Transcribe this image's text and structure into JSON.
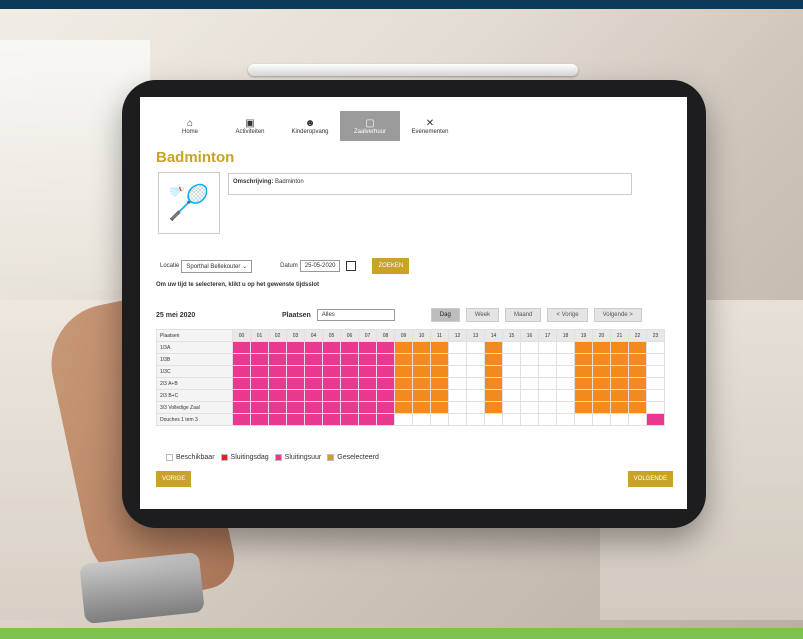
{
  "nav": [
    {
      "icon": "home-icon",
      "glyph": "⌂",
      "label": "Home",
      "active": false
    },
    {
      "icon": "calendar-icon",
      "glyph": "▣",
      "label": "Activiteiten",
      "active": false
    },
    {
      "icon": "child-icon",
      "glyph": "☻",
      "label": "Kinderopvang",
      "active": false
    },
    {
      "icon": "hall-icon",
      "glyph": "▢",
      "label": "Zaalverhuur",
      "active": true
    },
    {
      "icon": "party-icon",
      "glyph": "✕",
      "label": "Evenementen",
      "active": false
    }
  ],
  "page": {
    "title": "Badminton",
    "desc_label": "Omschrijving:",
    "desc_value": "Badminton",
    "locatie_label": "Locatie",
    "locatie_value": "Sporthal Bellekouter",
    "datum_label": "Datum",
    "datum_value": "25-05-2020",
    "search_label": "ZOEKEN",
    "hint": "Om uw tijd te selecteren, klikt u op het gewenste tijdsslot"
  },
  "controls": {
    "date": "25 mei 2020",
    "plaatsen_label": "Plaatsen",
    "plaatsen_value": "Alles",
    "dag": "Dag",
    "week": "Week",
    "maand": "Maand",
    "vorige": "< Vorige",
    "volgende": "Volgende >"
  },
  "grid": {
    "header_label": "Plaatsen",
    "hours": [
      "00",
      "01",
      "02",
      "03",
      "04",
      "05",
      "06",
      "07",
      "08",
      "09",
      "10",
      "11",
      "12",
      "13",
      "14",
      "15",
      "16",
      "17",
      "18",
      "19",
      "20",
      "21",
      "22",
      "23"
    ],
    "rows": [
      "1/3A",
      "1/3B",
      "1/3C",
      "2/3 A+B",
      "2/3 B+C",
      "3/3 Volledige Zaal",
      "Douches 1 tem 3"
    ],
    "states": [
      "CCCCCCCCCSSS__S__AASSSS_C",
      "CCCCCCCCCSSS__S__AASSSS_C",
      "CCCCCCCCCSSS__S__AASSSS_C",
      "CCCCCCCCCSSS__S__AASSSS_C",
      "CCCCCCCCCSSS__S__AASSSS_C",
      "CCCCCCCCCSSS__S__AASSSS_C",
      "CCCCCCCCC______________C"
    ],
    "colors": {
      "closed": "#e8388f",
      "selected": "#f28a1e",
      "available": "#ffffff",
      "day": "#e8388f"
    }
  },
  "legend": [
    {
      "label": "Beschikbaar",
      "color": "#ffffff"
    },
    {
      "label": "Sluitingsdag",
      "color": "#e02020"
    },
    {
      "label": "Sluitingsuur",
      "color": "#e8388f"
    },
    {
      "label": "Geselecteerd",
      "color": "#c9a227"
    }
  ],
  "buttons": {
    "prev": "VORIGE",
    "next": "VOLGENDE"
  }
}
